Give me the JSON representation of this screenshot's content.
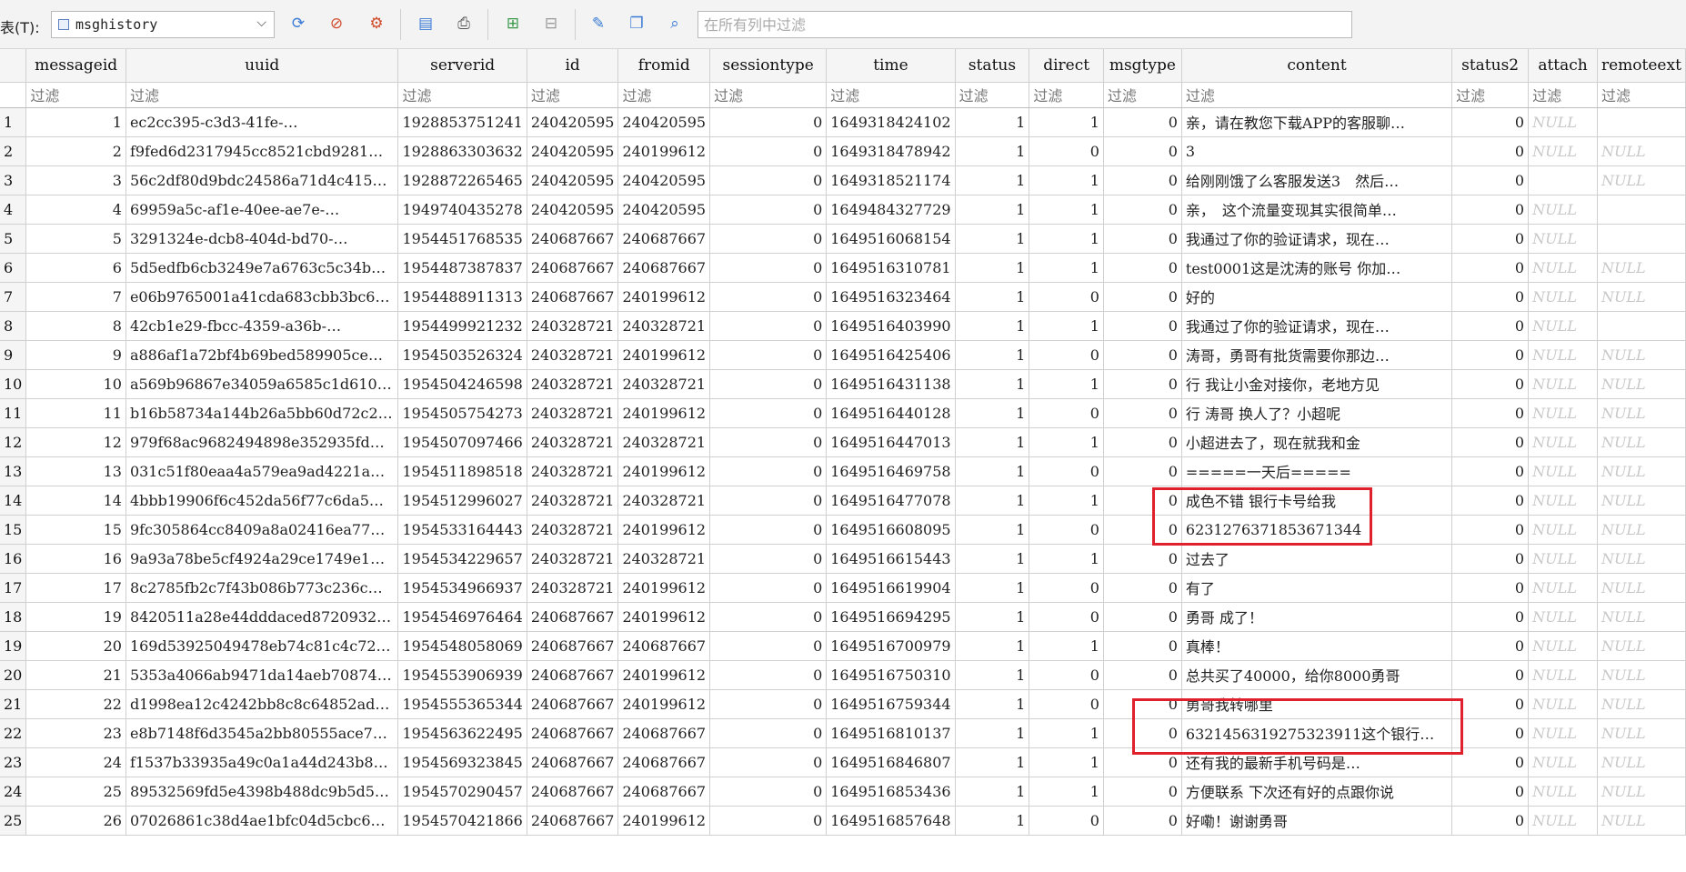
{
  "toolbar": {
    "table_label": "表(T):",
    "table_name": "msghistory",
    "filter_placeholder": "在所有列中过滤",
    "icons": [
      "refresh-icon",
      "clear-filter-icon",
      "filter-options-icon",
      "export-icon",
      "print-icon",
      "insert-row-icon",
      "delete-row-icon",
      "sql-icon",
      "copy-icon",
      "find-icon"
    ]
  },
  "grid": {
    "columns": [
      "messageid",
      "uuid",
      "serverid",
      "id",
      "fromid",
      "sessiontype",
      "time",
      "status",
      "direct",
      "msgtype",
      "content",
      "status2",
      "attach",
      "remoteext"
    ],
    "filter_text": "过滤",
    "null_text": "NULL",
    "rows": [
      {
        "rn": "1",
        "messageid": "1",
        "uuid": "ec2cc395-c3d3-41fe-…",
        "serverid": "1928853751241",
        "id": "240420595",
        "fromid": "240420595",
        "sessiontype": "0",
        "time": "1649318424102",
        "status": "1",
        "direct": "1",
        "msgtype": "0",
        "content": "亲，请在教您下载APP的客服聊…",
        "status2": "0",
        "attach": "NULL",
        "remoteext": ""
      },
      {
        "rn": "2",
        "messageid": "2",
        "uuid": "f9fed6d2317945cc8521cbd9281…",
        "serverid": "1928863303632",
        "id": "240420595",
        "fromid": "240199612",
        "sessiontype": "0",
        "time": "1649318478942",
        "status": "1",
        "direct": "0",
        "msgtype": "0",
        "content": "3",
        "status2": "0",
        "attach": "NULL",
        "remoteext": "NULL"
      },
      {
        "rn": "3",
        "messageid": "3",
        "uuid": "56c2df80d9bdc24586a71d4c415…",
        "serverid": "1928872265465",
        "id": "240420595",
        "fromid": "240420595",
        "sessiontype": "0",
        "time": "1649318521174",
        "status": "1",
        "direct": "1",
        "msgtype": "0",
        "content": "给刚刚饿了么客服发送3　然后…",
        "status2": "0",
        "attach": "",
        "remoteext": "NULL"
      },
      {
        "rn": "4",
        "messageid": "4",
        "uuid": "69959a5c-af1e-40ee-ae7e-…",
        "serverid": "1949740435278",
        "id": "240420595",
        "fromid": "240420595",
        "sessiontype": "0",
        "time": "1649484327729",
        "status": "1",
        "direct": "1",
        "msgtype": "0",
        "content": "亲，　这个流量变现其实很简单…",
        "status2": "0",
        "attach": "NULL",
        "remoteext": ""
      },
      {
        "rn": "5",
        "messageid": "5",
        "uuid": "3291324e-dcb8-404d-bd70-…",
        "serverid": "1954451768535",
        "id": "240687667",
        "fromid": "240687667",
        "sessiontype": "0",
        "time": "1649516068154",
        "status": "1",
        "direct": "1",
        "msgtype": "0",
        "content": "我通过了你的验证请求，现在…",
        "status2": "0",
        "attach": "NULL",
        "remoteext": ""
      },
      {
        "rn": "6",
        "messageid": "6",
        "uuid": "5d5edfb6cb3249e7a6763c5c34b…",
        "serverid": "1954487387837",
        "id": "240687667",
        "fromid": "240687667",
        "sessiontype": "0",
        "time": "1649516310781",
        "status": "1",
        "direct": "1",
        "msgtype": "0",
        "content": "test0001这是沈涛的账号 你加…",
        "status2": "0",
        "attach": "NULL",
        "remoteext": "NULL"
      },
      {
        "rn": "7",
        "messageid": "7",
        "uuid": "e06b9765001a41cda683cbb3bc6…",
        "serverid": "1954488911313",
        "id": "240687667",
        "fromid": "240199612",
        "sessiontype": "0",
        "time": "1649516323464",
        "status": "1",
        "direct": "0",
        "msgtype": "0",
        "content": "好的",
        "status2": "0",
        "attach": "NULL",
        "remoteext": "NULL"
      },
      {
        "rn": "8",
        "messageid": "8",
        "uuid": "42cb1e29-fbcc-4359-a36b-…",
        "serverid": "1954499921232",
        "id": "240328721",
        "fromid": "240328721",
        "sessiontype": "0",
        "time": "1649516403990",
        "status": "1",
        "direct": "1",
        "msgtype": "0",
        "content": "我通过了你的验证请求，现在…",
        "status2": "0",
        "attach": "NULL",
        "remoteext": ""
      },
      {
        "rn": "9",
        "messageid": "9",
        "uuid": "a886af1a72bf4b69bed589905ce…",
        "serverid": "1954503526324",
        "id": "240328721",
        "fromid": "240199612",
        "sessiontype": "0",
        "time": "1649516425406",
        "status": "1",
        "direct": "0",
        "msgtype": "0",
        "content": "涛哥，勇哥有批货需要你那边…",
        "status2": "0",
        "attach": "NULL",
        "remoteext": "NULL"
      },
      {
        "rn": "10",
        "messageid": "10",
        "uuid": "a569b96867e34059a6585c1d610…",
        "serverid": "1954504246598",
        "id": "240328721",
        "fromid": "240328721",
        "sessiontype": "0",
        "time": "1649516431138",
        "status": "1",
        "direct": "1",
        "msgtype": "0",
        "content": "行 我让小金对接你，老地方见",
        "status2": "0",
        "attach": "NULL",
        "remoteext": "NULL"
      },
      {
        "rn": "11",
        "messageid": "11",
        "uuid": "b16b58734a144b26a5bb60d72c2…",
        "serverid": "1954505754273",
        "id": "240328721",
        "fromid": "240199612",
        "sessiontype": "0",
        "time": "1649516440128",
        "status": "1",
        "direct": "0",
        "msgtype": "0",
        "content": "行 涛哥 换人了？小超呢",
        "status2": "0",
        "attach": "NULL",
        "remoteext": "NULL"
      },
      {
        "rn": "12",
        "messageid": "12",
        "uuid": "979f68ac9682494898e352935fd…",
        "serverid": "1954507097466",
        "id": "240328721",
        "fromid": "240328721",
        "sessiontype": "0",
        "time": "1649516447013",
        "status": "1",
        "direct": "1",
        "msgtype": "0",
        "content": "小超进去了，现在就我和金",
        "status2": "0",
        "attach": "NULL",
        "remoteext": "NULL"
      },
      {
        "rn": "13",
        "messageid": "13",
        "uuid": "031c51f80eaa4a579ea9ad4221a…",
        "serverid": "1954511898518",
        "id": "240328721",
        "fromid": "240199612",
        "sessiontype": "0",
        "time": "1649516469758",
        "status": "1",
        "direct": "0",
        "msgtype": "0",
        "content": "=====一天后=====",
        "status2": "0",
        "attach": "NULL",
        "remoteext": "NULL"
      },
      {
        "rn": "14",
        "messageid": "14",
        "uuid": "4bbb19906f6c452da56f77c6da5…",
        "serverid": "1954512996027",
        "id": "240328721",
        "fromid": "240328721",
        "sessiontype": "0",
        "time": "1649516477078",
        "status": "1",
        "direct": "1",
        "msgtype": "0",
        "content": "成色不错 银行卡号给我",
        "status2": "0",
        "attach": "NULL",
        "remoteext": "NULL"
      },
      {
        "rn": "15",
        "messageid": "15",
        "uuid": "9fc305864cc8409a8a02416ea77…",
        "serverid": "1954533164443",
        "id": "240328721",
        "fromid": "240199612",
        "sessiontype": "0",
        "time": "1649516608095",
        "status": "1",
        "direct": "0",
        "msgtype": "0",
        "content": "6231276371853671344",
        "status2": "0",
        "attach": "NULL",
        "remoteext": "NULL"
      },
      {
        "rn": "16",
        "messageid": "16",
        "uuid": "9a93a78be5cf4924a29ce1749e1…",
        "serverid": "1954534229657",
        "id": "240328721",
        "fromid": "240328721",
        "sessiontype": "0",
        "time": "1649516615443",
        "status": "1",
        "direct": "1",
        "msgtype": "0",
        "content": "过去了",
        "status2": "0",
        "attach": "NULL",
        "remoteext": "NULL"
      },
      {
        "rn": "17",
        "messageid": "17",
        "uuid": "8c2785fb2c7f43b086b773c236c…",
        "serverid": "1954534966937",
        "id": "240328721",
        "fromid": "240199612",
        "sessiontype": "0",
        "time": "1649516619904",
        "status": "1",
        "direct": "0",
        "msgtype": "0",
        "content": "有了",
        "status2": "0",
        "attach": "NULL",
        "remoteext": "NULL"
      },
      {
        "rn": "18",
        "messageid": "19",
        "uuid": "8420511a28e44dddaced8720932…",
        "serverid": "1954546976464",
        "id": "240687667",
        "fromid": "240199612",
        "sessiontype": "0",
        "time": "1649516694295",
        "status": "1",
        "direct": "0",
        "msgtype": "0",
        "content": "勇哥 成了！",
        "status2": "0",
        "attach": "NULL",
        "remoteext": "NULL"
      },
      {
        "rn": "19",
        "messageid": "20",
        "uuid": "169d53925049478eb74c81c4c72…",
        "serverid": "1954548058069",
        "id": "240687667",
        "fromid": "240687667",
        "sessiontype": "0",
        "time": "1649516700979",
        "status": "1",
        "direct": "1",
        "msgtype": "0",
        "content": "真棒！",
        "status2": "0",
        "attach": "NULL",
        "remoteext": "NULL"
      },
      {
        "rn": "20",
        "messageid": "21",
        "uuid": "5353a4066ab9471da14aeb70874…",
        "serverid": "1954553906939",
        "id": "240687667",
        "fromid": "240199612",
        "sessiontype": "0",
        "time": "1649516750310",
        "status": "1",
        "direct": "0",
        "msgtype": "0",
        "content": "总共买了40000，给你8000勇哥",
        "status2": "0",
        "attach": "NULL",
        "remoteext": "NULL"
      },
      {
        "rn": "21",
        "messageid": "22",
        "uuid": "d1998ea12c4242bb8c8c64852ad…",
        "serverid": "1954555365344",
        "id": "240687667",
        "fromid": "240199612",
        "sessiontype": "0",
        "time": "1649516759344",
        "status": "1",
        "direct": "0",
        "msgtype": "0",
        "content": "勇哥我转哪里",
        "status2": "0",
        "attach": "NULL",
        "remoteext": "NULL"
      },
      {
        "rn": "22",
        "messageid": "23",
        "uuid": "e8b7148f6d3545a2bb80555ace7…",
        "serverid": "1954563622495",
        "id": "240687667",
        "fromid": "240687667",
        "sessiontype": "0",
        "time": "1649516810137",
        "status": "1",
        "direct": "1",
        "msgtype": "0",
        "content": "6321456319275323911这个银行…",
        "status2": "0",
        "attach": "NULL",
        "remoteext": "NULL"
      },
      {
        "rn": "23",
        "messageid": "24",
        "uuid": "f1537b33935a49c0a1a44d243b8…",
        "serverid": "1954569323845",
        "id": "240687667",
        "fromid": "240687667",
        "sessiontype": "0",
        "time": "1649516846807",
        "status": "1",
        "direct": "1",
        "msgtype": "0",
        "content": "还有我的最新手机号码是…",
        "status2": "0",
        "attach": "NULL",
        "remoteext": "NULL"
      },
      {
        "rn": "24",
        "messageid": "25",
        "uuid": "89532569fd5e4398b488dc9b5d5…",
        "serverid": "1954570290457",
        "id": "240687667",
        "fromid": "240687667",
        "sessiontype": "0",
        "time": "1649516853436",
        "status": "1",
        "direct": "1",
        "msgtype": "0",
        "content": "方便联系 下次还有好的点跟你说",
        "status2": "0",
        "attach": "NULL",
        "remoteext": "NULL"
      },
      {
        "rn": "25",
        "messageid": "26",
        "uuid": "07026861c38d4ae1bfc04d5cbc6…",
        "serverid": "1954570421866",
        "id": "240687667",
        "fromid": "240199612",
        "sessiontype": "0",
        "time": "1649516857648",
        "status": "1",
        "direct": "0",
        "msgtype": "0",
        "content": "好嘞！谢谢勇哥",
        "status2": "0",
        "attach": "NULL",
        "remoteext": "NULL"
      }
    ]
  },
  "colors": {
    "highlight": "#e0202c",
    "header_bg": "#f5f5f5",
    "null_text": "#c8c8c8"
  }
}
